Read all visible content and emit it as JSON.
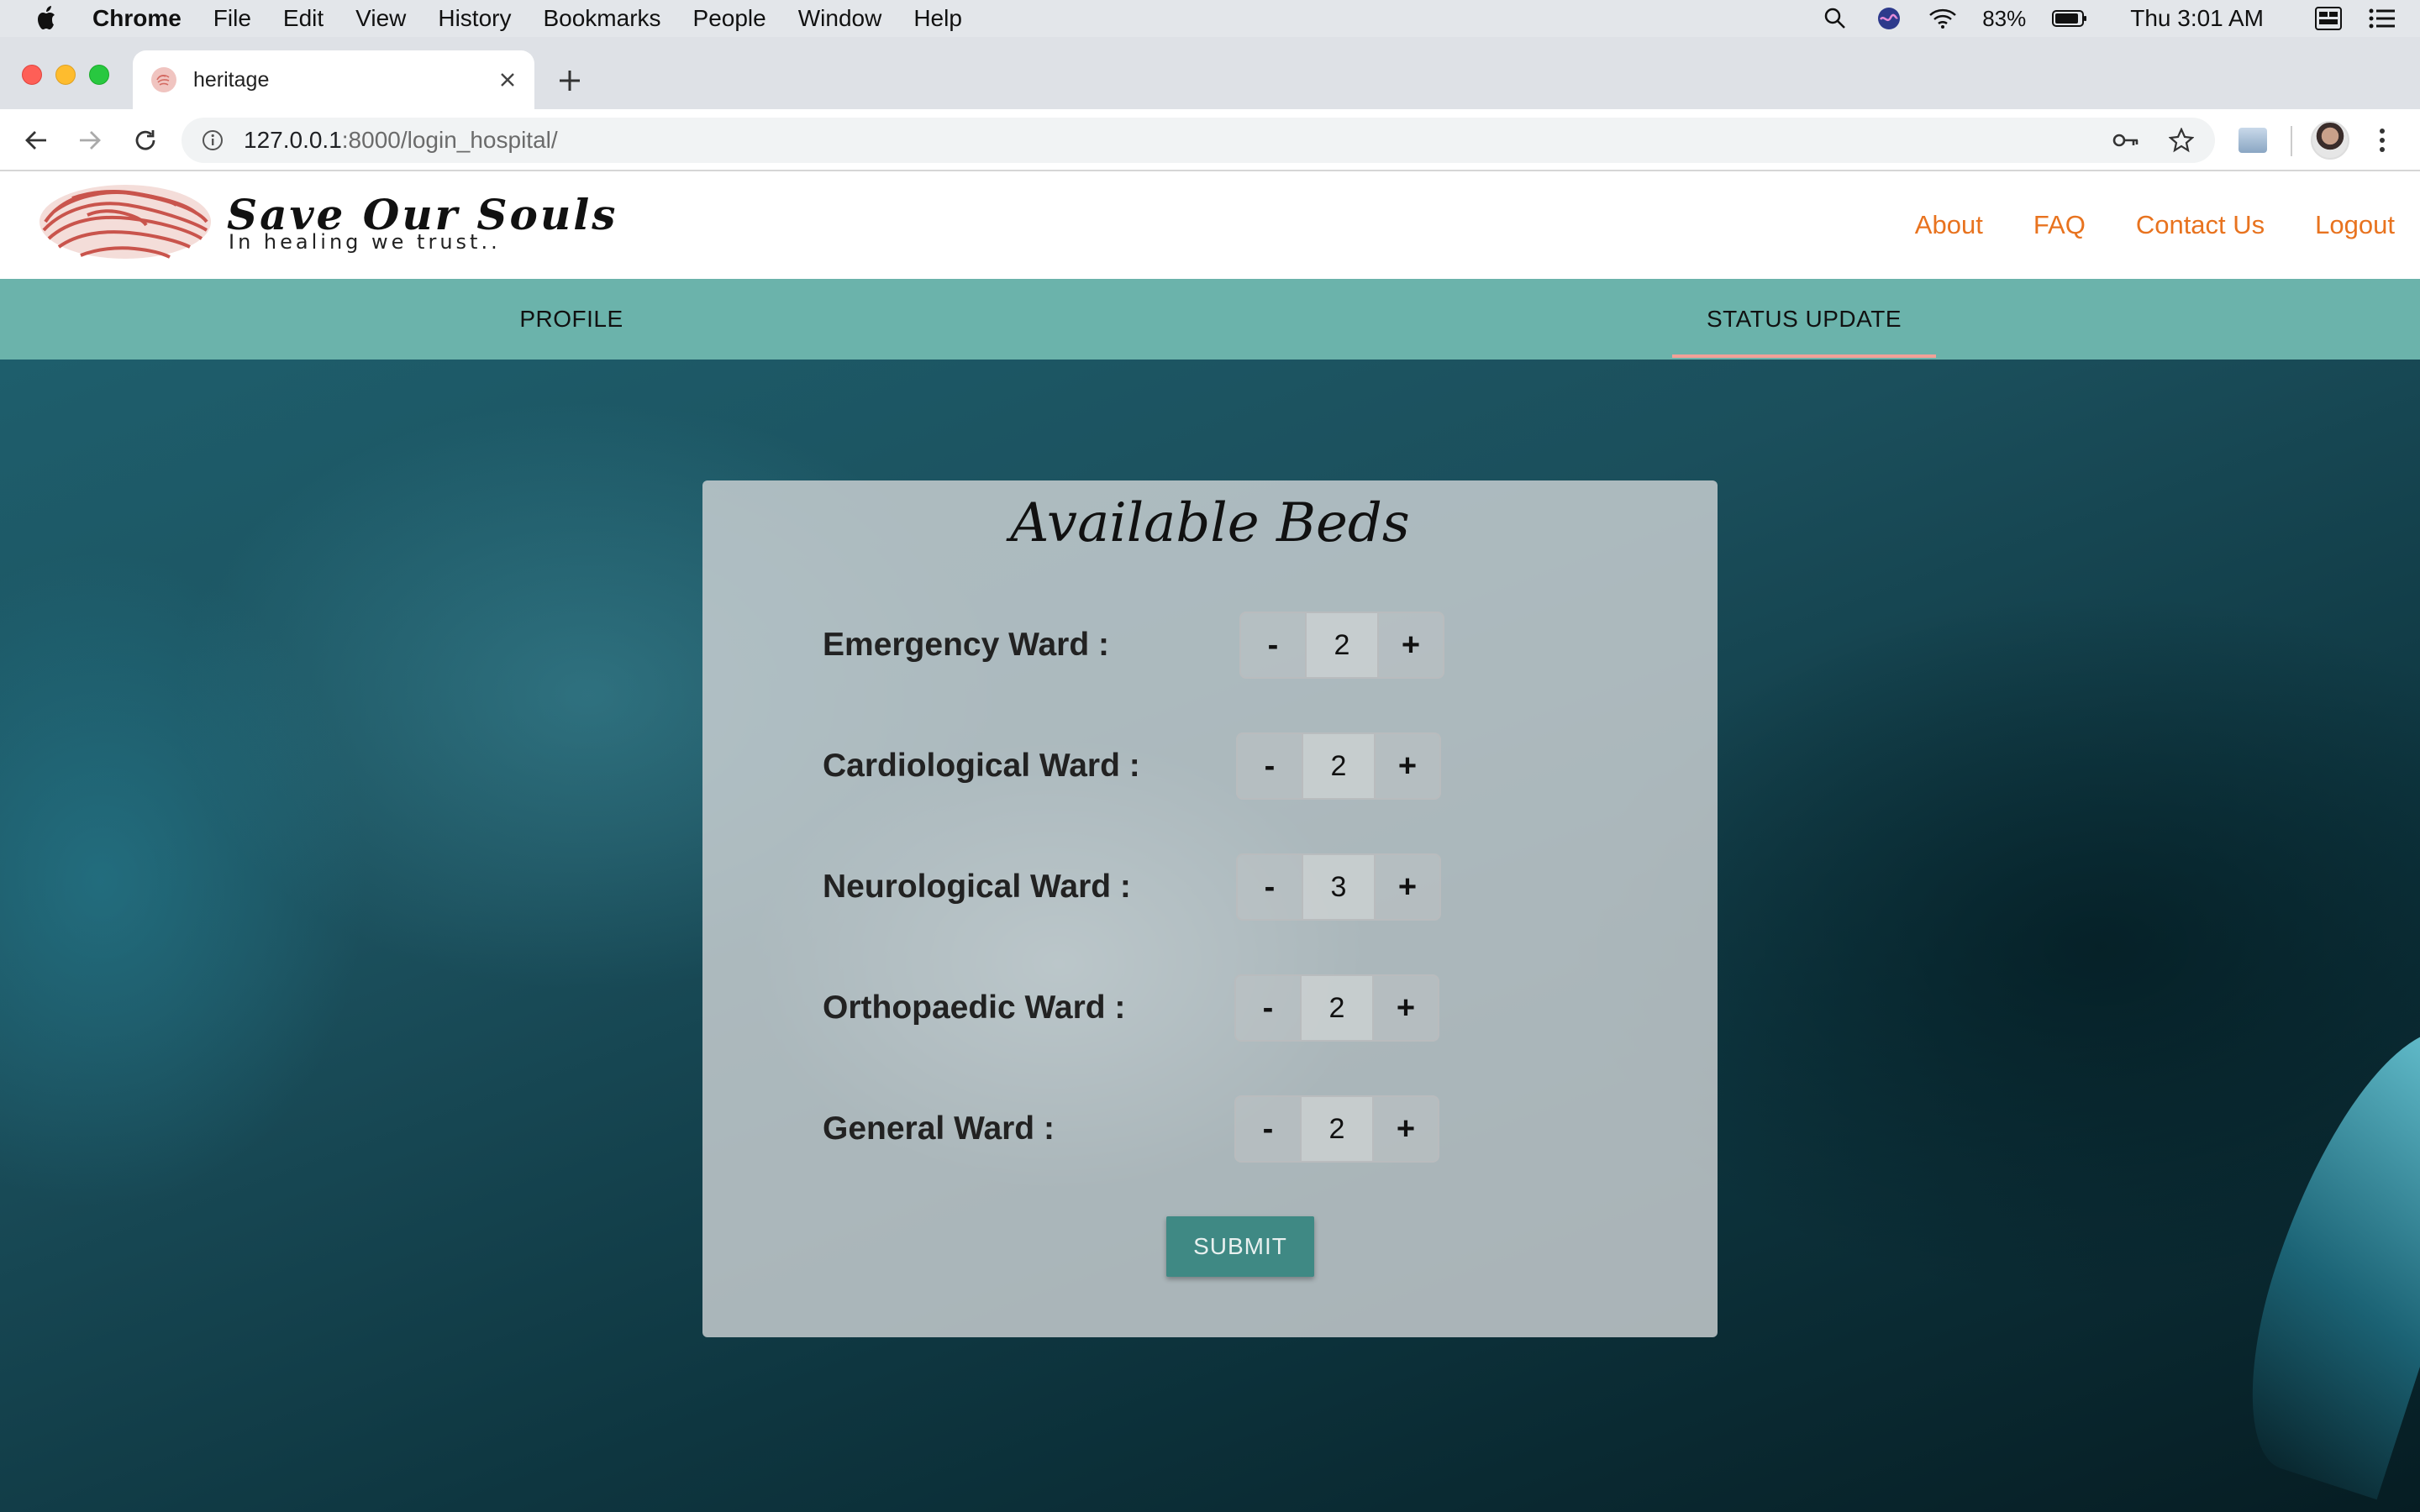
{
  "menubar": {
    "app": "Chrome",
    "items": [
      "File",
      "Edit",
      "View",
      "History",
      "Bookmarks",
      "People",
      "Window",
      "Help"
    ],
    "battery": "83%",
    "clock": "Thu 3:01 AM"
  },
  "browser": {
    "tab_title": "heritage",
    "url_host": "127.0.0.1",
    "url_path": ":8000/login_hospital/"
  },
  "site": {
    "brand": "Save Our Souls",
    "tagline": "In healing we trust..",
    "nav": [
      "About",
      "FAQ",
      "Contact Us",
      "Logout"
    ],
    "tabs": [
      "PROFILE",
      "STATUS UPDATE"
    ],
    "active_tab": "STATUS UPDATE"
  },
  "form": {
    "title": "Available Beds",
    "wards": [
      {
        "label": "Emergency Ward :",
        "value": "2"
      },
      {
        "label": "Cardiological Ward :",
        "value": "2"
      },
      {
        "label": "Neurological Ward :",
        "value": "3"
      },
      {
        "label": "Orthopaedic Ward :",
        "value": "2"
      },
      {
        "label": "General Ward :",
        "value": "2"
      }
    ],
    "minus": "-",
    "plus": "+",
    "submit": "SUBMIT"
  },
  "colors": {
    "nav_link": "#e8731f",
    "tabs_bar": "#6bb3ab",
    "active_underline": "#f2a097",
    "submit_bg": "#3f8984"
  }
}
